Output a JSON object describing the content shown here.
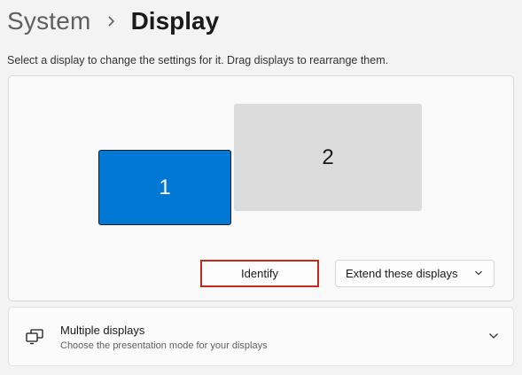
{
  "breadcrumb": {
    "parent": "System",
    "current": "Display",
    "separator_icon": "chevron-right-icon"
  },
  "instructions": "Select a display to change the settings for it. Drag displays to rearrange them.",
  "monitors": [
    {
      "label": "1",
      "selected": true,
      "color": "#0078d4"
    },
    {
      "label": "2",
      "selected": false,
      "color": "#dcdcdc"
    }
  ],
  "identify_button": {
    "label": "Identify",
    "highlight_color": "#c42b1c"
  },
  "display_mode": {
    "selected": "Extend these displays",
    "icon": "chevron-down-icon"
  },
  "multiple_displays": {
    "title": "Multiple displays",
    "subtitle": "Choose the presentation mode for your displays",
    "icon": "multiple-displays-icon",
    "expand_icon": "chevron-down-icon"
  },
  "colors": {
    "accent": "#0078d4",
    "background": "#f3f3f3"
  }
}
